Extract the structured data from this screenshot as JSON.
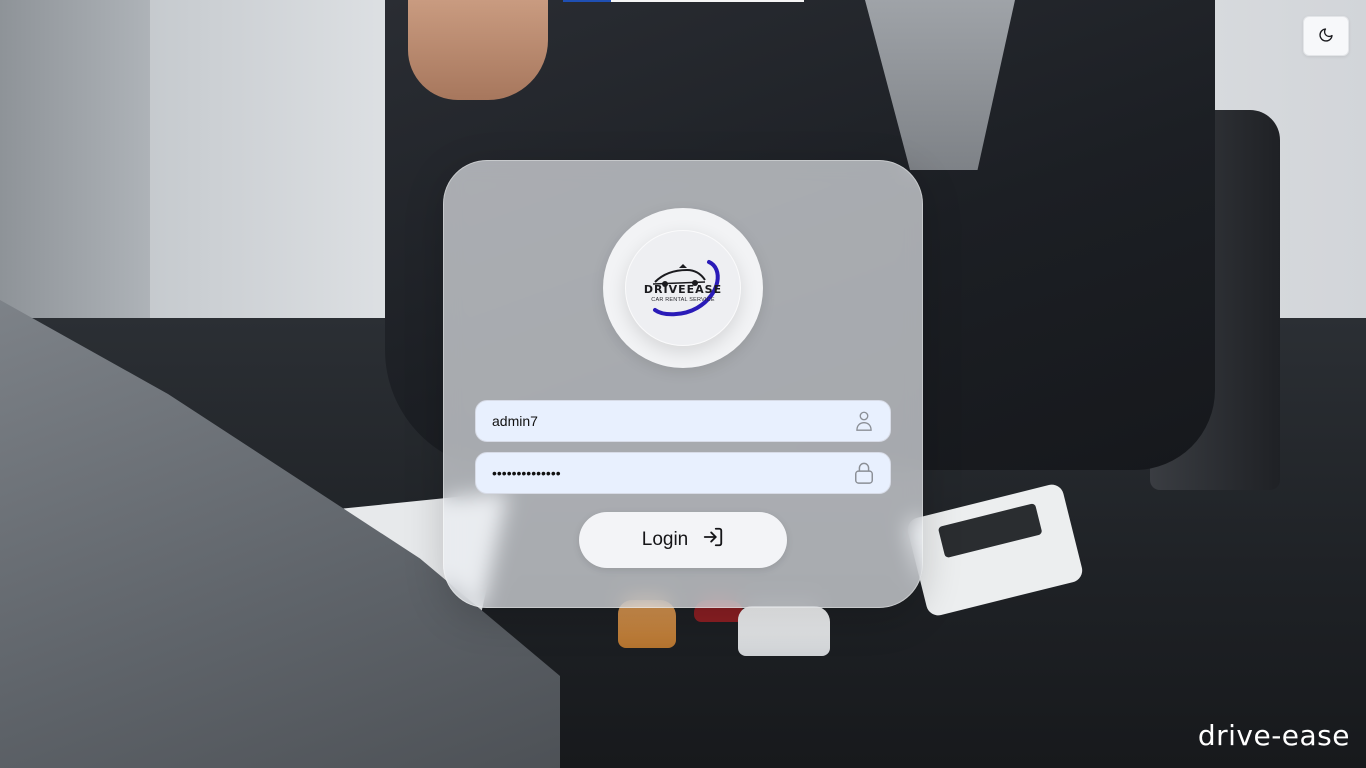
{
  "app": {
    "brand_name": "drive-ease"
  },
  "theme_toggle": {
    "icon": "moon-icon"
  },
  "logo": {
    "brand": "DRIVEEASE",
    "tagline": "CAR RENTAL SERVICE",
    "accent_color": "#2a1bb8"
  },
  "login_form": {
    "username": {
      "value": "admin7",
      "icon": "user-icon"
    },
    "password": {
      "value": "••••••••••••••",
      "icon": "lock-icon"
    },
    "submit": {
      "label": "Login",
      "icon": "login-arrow-icon"
    }
  },
  "colors": {
    "field_background": "#e8f0fe",
    "card_background": "#ebeef1",
    "button_background": "#f3f4f7"
  }
}
